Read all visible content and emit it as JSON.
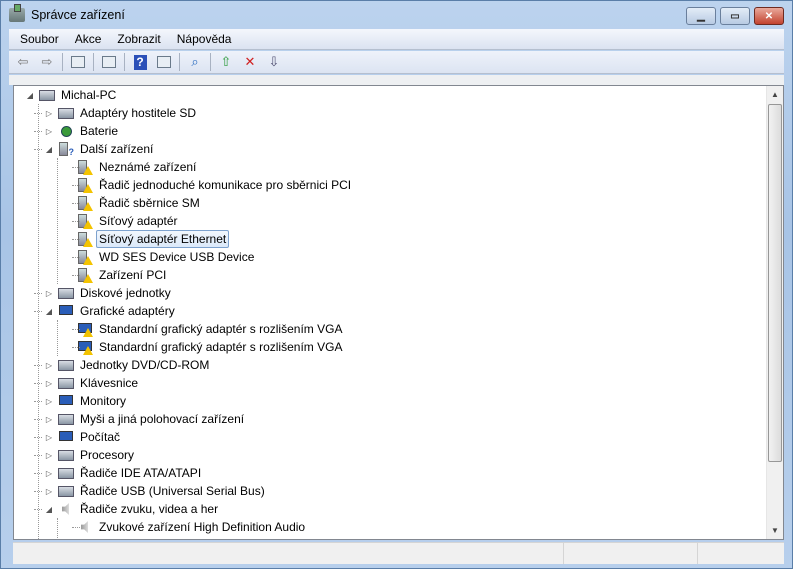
{
  "window": {
    "title": "Správce zařízení"
  },
  "menu": [
    "Soubor",
    "Akce",
    "Zobrazit",
    "Nápověda"
  ],
  "toolbar": [
    "back-icon",
    "forward-icon",
    "show-hide-console-tree-icon",
    "properties-icon",
    "help-icon",
    "show-hide-action-pane-icon",
    "scan-hardware-icon",
    "update-driver-icon",
    "uninstall-icon",
    "disable-icon"
  ],
  "tree": [
    {
      "level": 0,
      "label": "Michal-PC",
      "expanded": true,
      "icon": "computer"
    },
    {
      "level": 1,
      "label": "Adaptéry hostitele SD",
      "expanded": false,
      "icon": "box"
    },
    {
      "level": 1,
      "label": "Baterie",
      "expanded": false,
      "icon": "battery"
    },
    {
      "level": 1,
      "label": "Další zařízení",
      "expanded": true,
      "icon": "unknown"
    },
    {
      "level": 2,
      "label": "Neznámé zařízení",
      "icon": "warn"
    },
    {
      "level": 2,
      "label": "Řadič jednoduché komunikace pro sběrnici PCI",
      "icon": "warn"
    },
    {
      "level": 2,
      "label": "Řadič sběrnice SM",
      "icon": "warn"
    },
    {
      "level": 2,
      "label": "Síťový adaptér",
      "icon": "warn"
    },
    {
      "level": 2,
      "label": "Síťový adaptér Ethernet",
      "icon": "warn",
      "selected": true
    },
    {
      "level": 2,
      "label": "WD SES Device USB Device",
      "icon": "warn"
    },
    {
      "level": 2,
      "label": "Zařízení PCI",
      "icon": "warn"
    },
    {
      "level": 1,
      "label": "Diskové jednotky",
      "expanded": false,
      "icon": "box"
    },
    {
      "level": 1,
      "label": "Grafické adaptéry",
      "expanded": true,
      "icon": "monitor"
    },
    {
      "level": 2,
      "label": "Standardní grafický adaptér s rozlišením VGA",
      "icon": "monitor-warn"
    },
    {
      "level": 2,
      "label": "Standardní grafický adaptér s rozlišením VGA",
      "icon": "monitor-warn"
    },
    {
      "level": 1,
      "label": "Jednotky DVD/CD-ROM",
      "expanded": false,
      "icon": "box"
    },
    {
      "level": 1,
      "label": "Klávesnice",
      "expanded": false,
      "icon": "box"
    },
    {
      "level": 1,
      "label": "Monitory",
      "expanded": false,
      "icon": "monitor"
    },
    {
      "level": 1,
      "label": "Myši a jiná polohovací zařízení",
      "expanded": false,
      "icon": "box"
    },
    {
      "level": 1,
      "label": "Počítač",
      "expanded": false,
      "icon": "monitor"
    },
    {
      "level": 1,
      "label": "Procesory",
      "expanded": false,
      "icon": "box"
    },
    {
      "level": 1,
      "label": "Řadiče IDE ATA/ATAPI",
      "expanded": false,
      "icon": "box"
    },
    {
      "level": 1,
      "label": "Řadiče USB (Universal Serial Bus)",
      "expanded": false,
      "icon": "box"
    },
    {
      "level": 1,
      "label": "Řadiče zvuku, videa a her",
      "expanded": true,
      "icon": "speaker"
    },
    {
      "level": 2,
      "label": "Zvukové zařízení High Definition Audio",
      "icon": "speaker"
    }
  ]
}
